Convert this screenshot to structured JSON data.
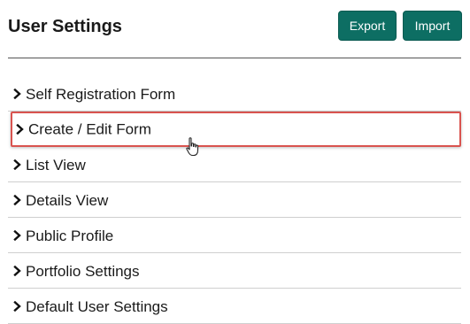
{
  "header": {
    "title": "User Settings",
    "export_label": "Export",
    "import_label": "Import"
  },
  "settings_list": {
    "items": [
      {
        "label": "Self Registration Form"
      },
      {
        "label": "Create / Edit Form"
      },
      {
        "label": "List View"
      },
      {
        "label": "Details View"
      },
      {
        "label": "Public Profile"
      },
      {
        "label": "Portfolio Settings"
      },
      {
        "label": "Default User Settings"
      }
    ],
    "highlighted_item": "Create / Edit Form"
  },
  "colors": {
    "button_bg": "#0d6e63",
    "highlight_border": "#d9534f"
  },
  "icons": {
    "chevron": "chevron-right-icon",
    "cursor": "hand-pointer-icon"
  }
}
